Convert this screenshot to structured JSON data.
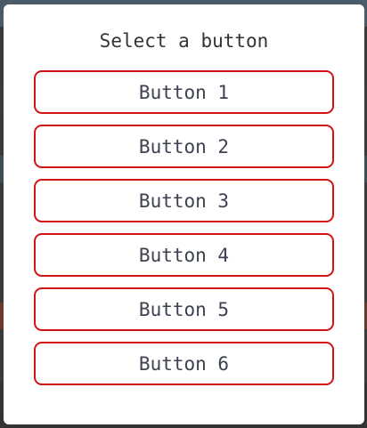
{
  "dialog": {
    "title": "Select a button",
    "buttons": [
      {
        "label": "Button 1"
      },
      {
        "label": "Button 2"
      },
      {
        "label": "Button 3"
      },
      {
        "label": "Button 4"
      },
      {
        "label": "Button 5"
      },
      {
        "label": "Button 6"
      }
    ]
  },
  "colors": {
    "accent_border": "#d41414",
    "button_text": "#3d4250",
    "dialog_bg": "#ffffff",
    "overlay": "#3a3a3a"
  }
}
